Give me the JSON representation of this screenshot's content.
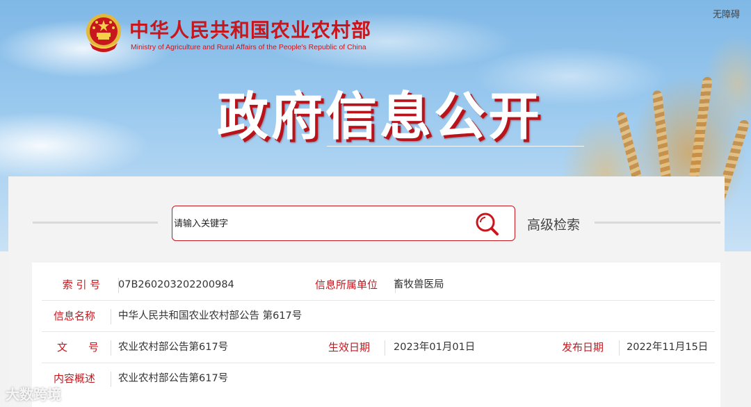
{
  "header": {
    "ministry_name_cn": "中华人民共和国农业农村部",
    "ministry_name_en": "Ministry of Agriculture and Rural Affairs of the People's Republic of China",
    "accessibility_link": "无障碍",
    "hero_title": "政府信息公开"
  },
  "search": {
    "placeholder": "请输入关键字",
    "advanced_label": "高级检索"
  },
  "info": {
    "index_label": "索 引 号",
    "index_value": "07B260203202200984",
    "unit_label": "信息所属单位",
    "unit_value": "畜牧兽医局",
    "name_label": "信息名称",
    "name_value": "中华人民共和国农业农村部公告 第617号",
    "doc_label": "文　　号",
    "doc_value": "农业农村部公告第617号",
    "effective_label": "生效日期",
    "effective_value": "2023年01月01日",
    "publish_label": "发布日期",
    "publish_value": "2022年11月15日",
    "summary_label": "内容概述",
    "summary_value": "农业农村部公告第617号"
  },
  "watermark": "大数跨境",
  "colors": {
    "brand_red": "#c8161d",
    "sky_blue": "#8fc2ec",
    "panel_bg": "#f3f3f3"
  },
  "icons": [
    "national-emblem-icon",
    "search-icon"
  ]
}
